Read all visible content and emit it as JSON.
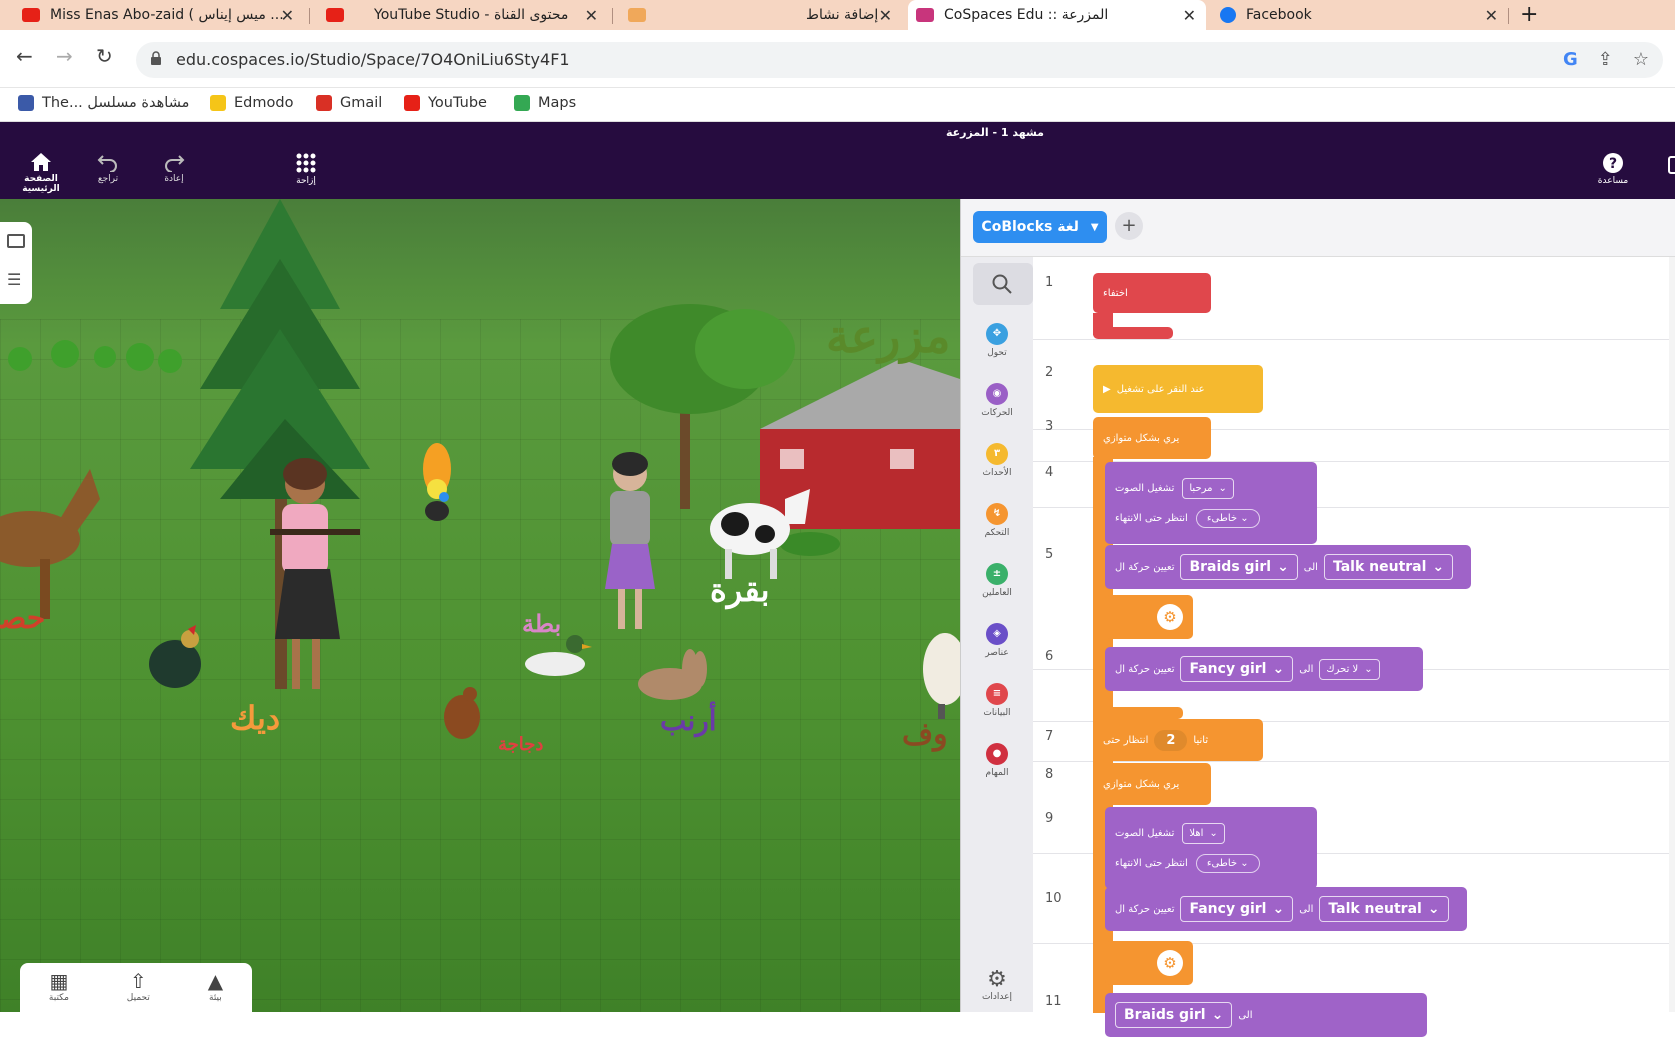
{
  "browser": {
    "tabs": [
      {
        "title": "Miss Enas Abo-zaid ( ميس إيناس ...",
        "favicon": "youtube-icon",
        "color": "#e62117"
      },
      {
        "title": "YouTube Studio - محتوى القناة",
        "favicon": "youtube-icon",
        "color": "#e62117"
      },
      {
        "title": "إضافة نشاط",
        "favicon": "activity-icon",
        "color": "#f0a85a"
      },
      {
        "title": "CoSpaces Edu :: المزرعة",
        "favicon": "cospaces-icon",
        "color": "#c8357c"
      },
      {
        "title": "Facebook",
        "favicon": "facebook-icon",
        "color": "#1877f2"
      }
    ],
    "new_tab_glyph": "+",
    "url": "edu.cospaces.io/Studio/Space/7O4OniLiu6Sty4F1",
    "bookmarks": [
      {
        "label": "The... مشاهدة مسلسل",
        "icon": "m-icon",
        "color": "#3b5aa8"
      },
      {
        "label": "Edmodo",
        "icon": "edmodo-icon",
        "color": "#f5c518"
      },
      {
        "label": "Gmail",
        "icon": "gmail-icon",
        "color": "#d93025"
      },
      {
        "label": "YouTube",
        "icon": "youtube-icon",
        "color": "#e62117"
      },
      {
        "label": "Maps",
        "icon": "maps-icon",
        "color": "#34a853"
      }
    ]
  },
  "app": {
    "scene_title": "مشهد 1 - المزرعة",
    "home_label": "الصفحة الرئيسية",
    "undo_label": "تراجع",
    "redo_label": "إعادة",
    "grid_label": "إزاحة",
    "help_label": "مساعدة"
  },
  "scene_labels": [
    {
      "text": "مزرعة",
      "color": "#5a8a2a"
    },
    {
      "text": "بقرة",
      "color": "#ffffff"
    },
    {
      "text": "بطة",
      "color": "#d986c8"
    },
    {
      "text": "ديك",
      "color": "#f59a3c"
    },
    {
      "text": "دجاجة",
      "color": "#e04040"
    },
    {
      "text": "أرنب",
      "color": "#6a3aa8"
    },
    {
      "text": "حصـ",
      "color": "#d0402a"
    },
    {
      "text": "وف",
      "color": "#8a4a22"
    }
  ],
  "library": {
    "items": [
      {
        "label": "مكتبة",
        "icon": "library-icon"
      },
      {
        "label": "تحميل",
        "icon": "upload-icon"
      },
      {
        "label": "بيئة",
        "icon": "environment-icon"
      }
    ]
  },
  "code": {
    "coblocks_label": "CoBlocks لغة",
    "add_glyph": "+",
    "palette": [
      {
        "label": "تحول",
        "color": "#3aa0e0",
        "glyph": "✥"
      },
      {
        "label": "الحركات",
        "color": "#9a5fc6",
        "glyph": "◉"
      },
      {
        "label": "الأحداث",
        "color": "#f5b92f",
        "glyph": "٣"
      },
      {
        "label": "التحكم",
        "color": "#f59530",
        "glyph": "↯"
      },
      {
        "label": "العاملين",
        "color": "#3ab06a",
        "glyph": "±"
      },
      {
        "label": "عناصر",
        "color": "#6a4fc8",
        "glyph": "◈"
      },
      {
        "label": "البيانات",
        "color": "#e0474c",
        "glyph": "≡"
      },
      {
        "label": "المهام",
        "color": "#d03040",
        "glyph": "●"
      }
    ],
    "settings_label": "إعدادات",
    "lines": [
      "1",
      "2",
      "3",
      "4",
      "5",
      "6",
      "7",
      "8",
      "9",
      "10",
      "11"
    ],
    "blocks": {
      "hide": "اختفاء",
      "on_run": "عند النقر على تشغيل",
      "parallel": "يري بشكل متوازي",
      "play_sound": "تشغيل الصوت",
      "sound1": "مرحبا",
      "wait_until_end": "انتظر حتى الانتهاء",
      "false_value": "خاطىء",
      "set_animation": "تعيين حركة ال",
      "to": "الى",
      "braids_girl": "Braids girl",
      "talk_neutral": "Talk neutral",
      "fancy_girl": "Fancy girl",
      "dont_move": "لا تحرك",
      "wait_for": "انتظار حتى",
      "seconds": "ثانيا",
      "wait_value": "2",
      "sound2": "اهلا"
    }
  }
}
